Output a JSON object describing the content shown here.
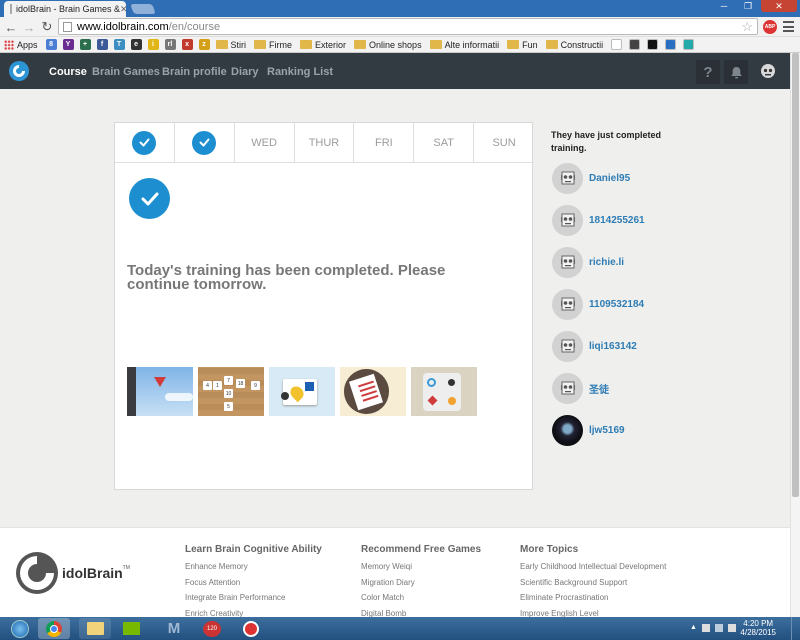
{
  "browser": {
    "tab_title": "idolBrain - Brain Games &",
    "url_host": "www.idolbrain.com",
    "url_path": "/en/course",
    "bookmarks": [
      {
        "label": "Apps",
        "icon": "apps-grid-icon",
        "color": "#c44"
      },
      {
        "label": "",
        "icon": "google-icon",
        "color": "#4a7fd4",
        "glyph": "8"
      },
      {
        "label": "",
        "icon": "yahoo-icon",
        "color": "#6b2c91",
        "glyph": "Y"
      },
      {
        "label": "",
        "icon": "bookmark-icon",
        "color": "#2a6e4e",
        "glyph": "+"
      },
      {
        "label": "",
        "icon": "facebook-icon",
        "color": "#3b5998",
        "glyph": "f"
      },
      {
        "label": "",
        "icon": "bookmark-icon",
        "color": "#3b8ec2",
        "glyph": "T"
      },
      {
        "label": "",
        "icon": "bookmark-icon",
        "color": "#333",
        "glyph": "e"
      },
      {
        "label": "",
        "icon": "imdb-icon",
        "color": "#e2b616",
        "glyph": "i"
      },
      {
        "label": "",
        "icon": "bookmark-icon",
        "color": "#777",
        "glyph": "rl"
      },
      {
        "label": "",
        "icon": "bookmark-icon",
        "color": "#c0392b",
        "glyph": "x"
      },
      {
        "label": "",
        "icon": "bookmark-icon",
        "color": "#d4a017",
        "glyph": "z"
      },
      {
        "label": "Stiri",
        "icon": "folder-icon"
      },
      {
        "label": "Firme",
        "icon": "folder-icon"
      },
      {
        "label": "Exterior",
        "icon": "folder-icon"
      },
      {
        "label": "Online shops",
        "icon": "folder-icon"
      },
      {
        "label": "Alte informatii",
        "icon": "folder-icon"
      },
      {
        "label": "Fun",
        "icon": "folder-icon"
      },
      {
        "label": "Constructii",
        "icon": "folder-icon"
      }
    ]
  },
  "site": {
    "nav": [
      "Course",
      "Brain Games",
      "Brain profile",
      "Diary",
      "Ranking List"
    ],
    "help_glyph": "?",
    "accent": "#1d8fd0"
  },
  "course": {
    "days": [
      {
        "label": "",
        "done": true
      },
      {
        "label": "",
        "done": true
      },
      {
        "label": "WED",
        "done": false
      },
      {
        "label": "THUR",
        "done": false
      },
      {
        "label": "FRI",
        "done": false
      },
      {
        "label": "SAT",
        "done": false
      },
      {
        "label": "SUN",
        "done": false
      }
    ],
    "completed_message": "Today's training has been completed. Please continue tomorrow.",
    "game_tiles": [
      "game-flight-icon",
      "game-number-grid-icon",
      "game-shapes-icon",
      "game-paper-icon",
      "game-puzzle-icon"
    ],
    "number_tiles": [
      "4",
      "1",
      "7",
      "18",
      "9",
      "10",
      "5"
    ]
  },
  "sidebar": {
    "title": "They have just completed training.",
    "users": [
      "Daniel95",
      "1814255261",
      "richie.li",
      "1109532184",
      "liqi163142",
      "圣徒",
      "ljw5169"
    ]
  },
  "footer": {
    "logo_text": "idolBrain",
    "logo_mark": "TM",
    "columns": [
      {
        "heading": "Learn Brain Cognitive Ability",
        "links": [
          "Enhance Memory",
          "Focus Attention",
          "Integrate Brain Performance",
          "Enrich Creativity"
        ]
      },
      {
        "heading": "Recommend Free Games",
        "links": [
          "Memory Weiqi",
          "Migration Diary",
          "Color Match",
          "Digital Bomb"
        ]
      },
      {
        "heading": "More Topics",
        "links": [
          "Early Childhood Intellectual Development",
          "Scientific Background Support",
          "Eliminate Procrastination",
          "Improve English Level"
        ]
      }
    ]
  },
  "taskbar": {
    "time": "4:20 PM",
    "date": "4/28/2015",
    "apps": [
      "windows-start-icon",
      "chrome-icon",
      "file-explorer-icon",
      "nvidia-icon",
      "m-app-icon",
      "speedtest-icon",
      "media-icon"
    ]
  }
}
